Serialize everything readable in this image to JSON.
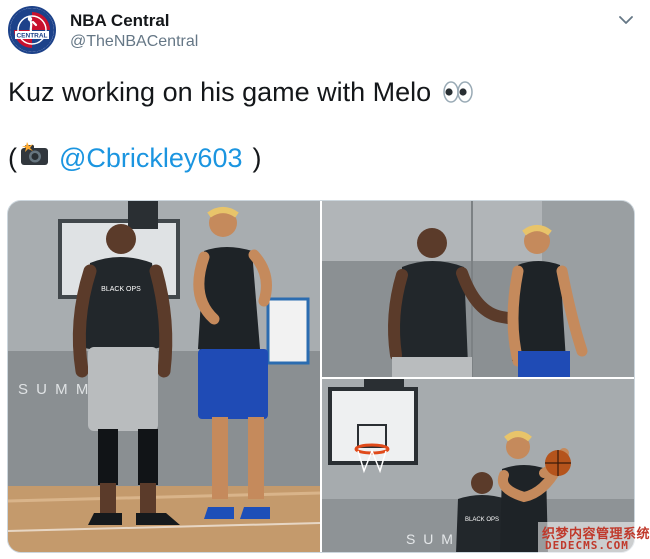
{
  "author": {
    "display_name": "NBA Central",
    "handle": "@TheNBACentral",
    "avatar_text": "CENTRAL",
    "avatar_colors": {
      "blue": "#1d428a",
      "red": "#c8102e"
    }
  },
  "tweet": {
    "text": "Kuz working on his game with Melo",
    "text_emoji": "eyes-emoji",
    "credit_open": "(",
    "credit_emoji": "camera-flash-emoji",
    "mention": "@Cbrickley603",
    "credit_close": ")"
  },
  "media": {
    "photos": [
      {
        "id": "photo-1",
        "jersey_text": "BLACK OPS",
        "wall_text": "S U M M"
      },
      {
        "id": "photo-2"
      },
      {
        "id": "photo-3",
        "jersey_text": "BLACK OPS",
        "wall_text": "S U M"
      }
    ]
  },
  "watermark": {
    "chinese": "织梦内容管理系统",
    "english": "DEDECMS.COM"
  },
  "colors": {
    "link": "#1b95e0",
    "text": "#14171a",
    "secondary": "#657786"
  }
}
